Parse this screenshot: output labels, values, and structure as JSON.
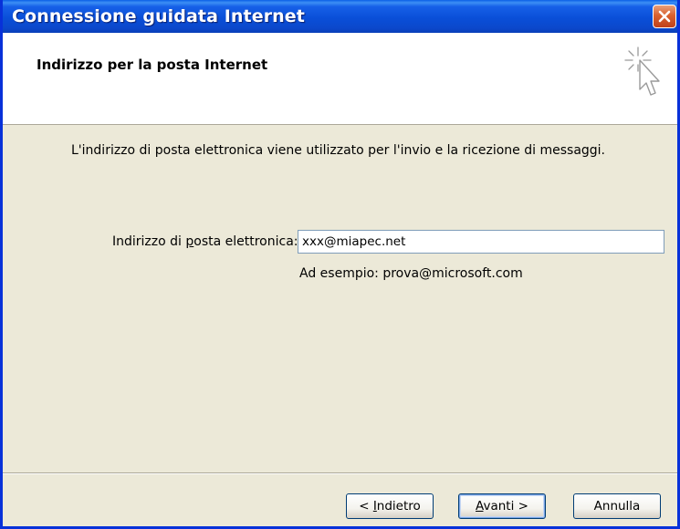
{
  "window": {
    "title": "Connessione guidata Internet"
  },
  "header": {
    "title": "Indirizzo per la posta Internet"
  },
  "content": {
    "description": "L'indirizzo di posta elettronica viene utilizzato per l'invio e la ricezione di messaggi.",
    "email_label_pre": "Indirizzo di ",
    "email_label_mnemonic": "p",
    "email_label_post": "osta elettronica:",
    "email_value": "xxx@miapec.net",
    "example_text": "Ad esempio: prova@microsoft.com"
  },
  "buttons": {
    "back_pre": "< ",
    "back_mnemonic": "I",
    "back_post": "ndietro",
    "next_mnemonic": "A",
    "next_post": "vanti >",
    "cancel": "Annulla"
  },
  "icons": {
    "close": "close-icon",
    "wizard": "wizard-cursor-icon"
  },
  "colors": {
    "titlebar": "#0a4fd8",
    "dialog_bg": "#ece9d8",
    "close_button": "#d9612e"
  }
}
